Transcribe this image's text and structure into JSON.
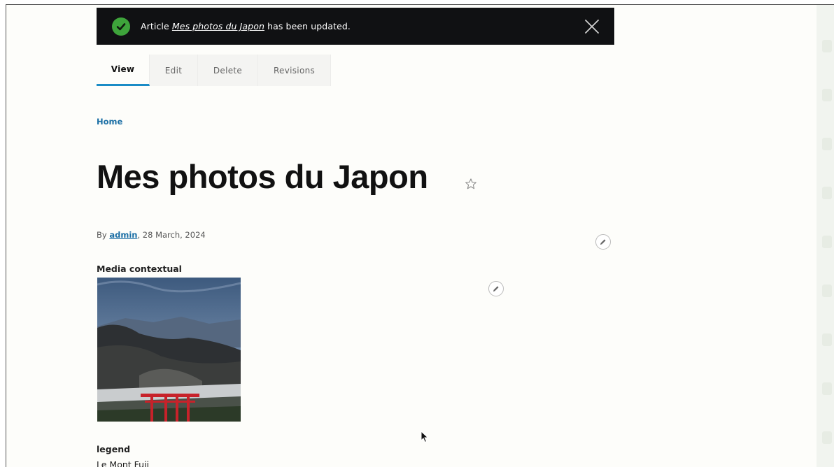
{
  "status": {
    "prefix": "Article",
    "link_text": "Mes photos du Japon",
    "suffix": "has been updated.",
    "icon": "check-circle-icon",
    "close_icon": "close-icon"
  },
  "tabs": [
    {
      "label": "View",
      "active": true
    },
    {
      "label": "Edit",
      "active": false
    },
    {
      "label": "Delete",
      "active": false
    },
    {
      "label": "Revisions",
      "active": false
    }
  ],
  "breadcrumb": {
    "home": "Home"
  },
  "article": {
    "title": "Mes photos du Japon",
    "byline_prefix": "By",
    "author": "admin",
    "date": ", 28 March, 2024",
    "media_label": "Media contextual",
    "legend_label": "legend",
    "legend_value": "Le Mont Fuji"
  },
  "colors": {
    "accent": "#1b8cc6",
    "link": "#1b6fa5",
    "success": "#3ea43b",
    "status_bg": "#101113"
  }
}
